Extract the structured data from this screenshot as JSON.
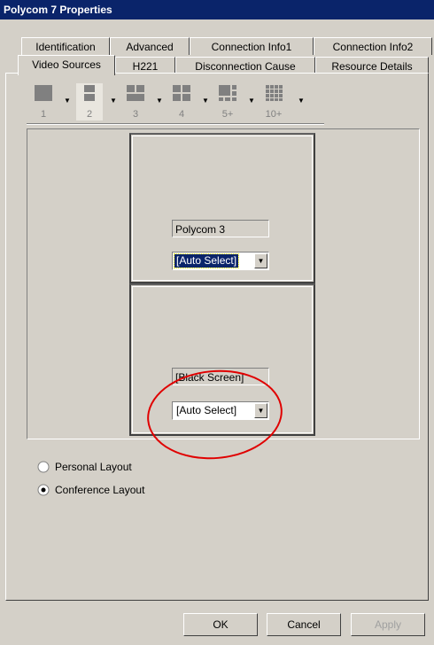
{
  "window": {
    "title": "Polycom 7 Properties"
  },
  "tabs_row1": [
    "Identification",
    "Advanced",
    "Connection Info1",
    "Connection Info2"
  ],
  "tabs_row2": [
    "Video Sources",
    "H221",
    "Disconnection Cause",
    "Resource Details"
  ],
  "active_tab": "Video Sources",
  "layouts": [
    "1",
    "2",
    "3",
    "4",
    "5+",
    "10+"
  ],
  "selected_layout": "2",
  "panels": [
    {
      "source": "Polycom 3",
      "select": "[Auto Select]"
    },
    {
      "source": "[Black Screen]",
      "select": "[Auto Select]"
    }
  ],
  "radio": {
    "personal": "Personal Layout",
    "conference": "Conference Layout",
    "selected": "conference"
  },
  "buttons": {
    "ok": "OK",
    "cancel": "Cancel",
    "apply": "Apply"
  },
  "colors": {
    "title_bg": "#0a246a",
    "face": "#d4d0c8",
    "annotation": "#e00000"
  }
}
